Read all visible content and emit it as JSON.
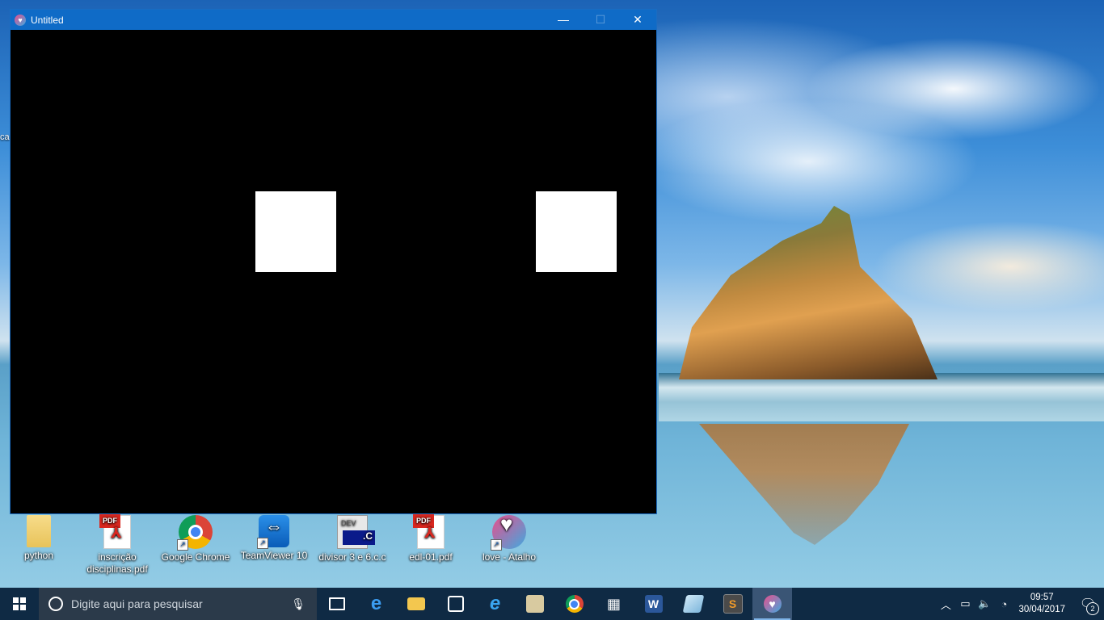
{
  "window": {
    "title": "Untitled",
    "minimize_glyph": "—",
    "maximize_glyph": "☐",
    "close_glyph": "✕"
  },
  "canvas": {
    "background": "#000000",
    "square_color": "#ffffff"
  },
  "desktop": {
    "edge_label": "ca",
    "icons": [
      {
        "label": "python",
        "icon": "folder-icon"
      },
      {
        "label": "inscrição disciplinas.pdf",
        "icon": "pdf-icon"
      },
      {
        "label": "Google Chrome",
        "icon": "chrome-icon"
      },
      {
        "label": "TeamViewer 10",
        "icon": "teamviewer-icon"
      },
      {
        "label": "divisor 3 e 6.c.c",
        "icon": "dev-c-file-icon"
      },
      {
        "label": "edl-01.pdf",
        "icon": "pdf-icon"
      },
      {
        "label": "love - Atalho",
        "icon": "love-icon"
      }
    ],
    "pdf_tag": "PDF",
    "dev_tag": "DEV",
    "dev_ext": ".C"
  },
  "taskbar": {
    "search_placeholder": "Digite aqui para pesquisar",
    "apps": [
      "task-view",
      "edge",
      "file-explorer",
      "store",
      "internet-explorer",
      "notepad",
      "chrome",
      "calculator",
      "word",
      "sticky",
      "sublime-text",
      "love"
    ],
    "word_letter": "W",
    "sublime_letter": "S",
    "clock_time": "09:57",
    "clock_date": "30/04/2017",
    "notification_count": "2"
  }
}
